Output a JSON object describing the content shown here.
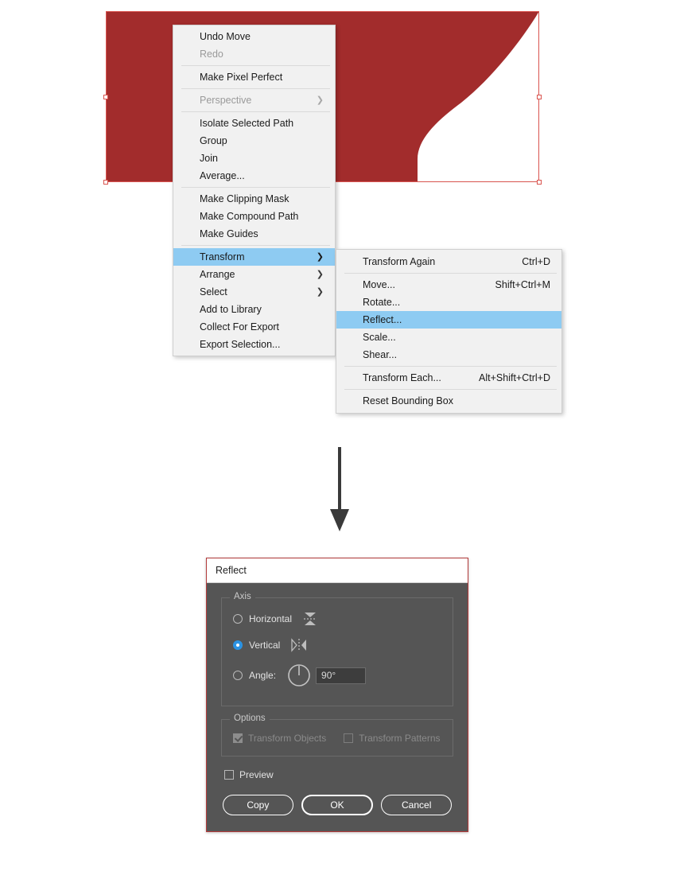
{
  "app": {
    "accent_red": "#a22c2c",
    "selection_color": "#d9544f",
    "menu_highlight": "#8ecbf2",
    "dialog_bg": "#555555",
    "radio_accent": "#2b93e4"
  },
  "artwork": {
    "name": "red-curved-shape",
    "fill": "#a22c2c",
    "selection_handles": 4
  },
  "flow_arrow": {
    "name": "down-arrow",
    "direction": "down"
  },
  "context_menu": {
    "name": "illustrator-context-menu",
    "groups": [
      [
        {
          "label": "Undo Move",
          "disabled": false,
          "submenu": false
        },
        {
          "label": "Redo",
          "disabled": true,
          "submenu": false
        }
      ],
      [
        {
          "label": "Make Pixel Perfect",
          "disabled": false,
          "submenu": false
        }
      ],
      [
        {
          "label": "Perspective",
          "disabled": true,
          "submenu": true
        }
      ],
      [
        {
          "label": "Isolate Selected Path",
          "disabled": false,
          "submenu": false
        },
        {
          "label": "Group",
          "disabled": false,
          "submenu": false
        },
        {
          "label": "Join",
          "disabled": false,
          "submenu": false
        },
        {
          "label": "Average...",
          "disabled": false,
          "submenu": false
        }
      ],
      [
        {
          "label": "Make Clipping Mask",
          "disabled": false,
          "submenu": false
        },
        {
          "label": "Make Compound Path",
          "disabled": false,
          "submenu": false
        },
        {
          "label": "Make Guides",
          "disabled": false,
          "submenu": false
        }
      ],
      [
        {
          "label": "Transform",
          "disabled": false,
          "submenu": true,
          "highlighted": true
        },
        {
          "label": "Arrange",
          "disabled": false,
          "submenu": true
        },
        {
          "label": "Select",
          "disabled": false,
          "submenu": true
        },
        {
          "label": "Add to Library",
          "disabled": false,
          "submenu": false
        },
        {
          "label": "Collect For Export",
          "disabled": false,
          "submenu": false
        },
        {
          "label": "Export Selection...",
          "disabled": false,
          "submenu": false
        }
      ]
    ]
  },
  "submenu": {
    "name": "transform-submenu",
    "groups": [
      [
        {
          "label": "Transform Again",
          "accel": "Ctrl+D"
        }
      ],
      [
        {
          "label": "Move...",
          "accel": "Shift+Ctrl+M"
        },
        {
          "label": "Rotate...",
          "accel": ""
        },
        {
          "label": "Reflect...",
          "accel": "",
          "highlighted": true
        },
        {
          "label": "Scale...",
          "accel": ""
        },
        {
          "label": "Shear...",
          "accel": ""
        }
      ],
      [
        {
          "label": "Transform Each...",
          "accel": "Alt+Shift+Ctrl+D"
        }
      ],
      [
        {
          "label": "Reset Bounding Box",
          "accel": ""
        }
      ]
    ]
  },
  "dialog": {
    "title": "Reflect",
    "axis": {
      "legend": "Axis",
      "horizontal_label": "Horizontal",
      "vertical_label": "Vertical",
      "angle_label": "Angle:",
      "selected": "Vertical",
      "angle_value": "90°"
    },
    "options": {
      "legend": "Options",
      "transform_objects_label": "Transform Objects",
      "transform_objects_checked": true,
      "transform_patterns_label": "Transform Patterns",
      "transform_patterns_checked": false
    },
    "preview": {
      "label": "Preview",
      "checked": false
    },
    "buttons": {
      "copy": "Copy",
      "ok": "OK",
      "cancel": "Cancel"
    }
  }
}
